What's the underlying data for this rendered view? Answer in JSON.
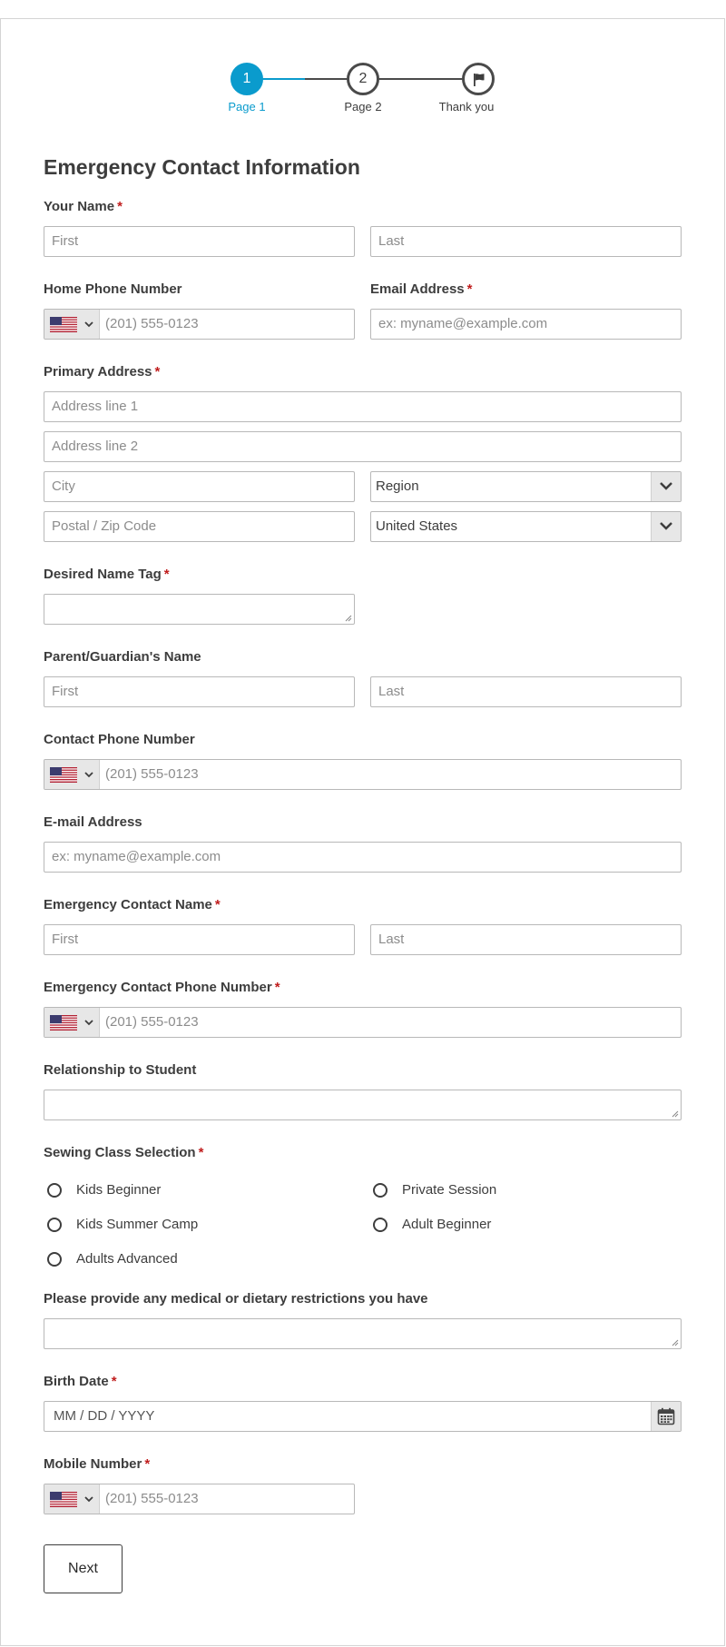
{
  "progress": {
    "steps": [
      {
        "number": "1",
        "label": "Page 1",
        "state": "active"
      },
      {
        "number": "2",
        "label": "Page 2",
        "state": "todo"
      },
      {
        "number": "",
        "label": "Thank you",
        "state": "todo",
        "icon": "flag-icon"
      }
    ],
    "colors": {
      "active": "#0a9bcd",
      "inactive": "#4a4a4a"
    }
  },
  "form": {
    "title": "Emergency Contact Information",
    "required_marker": "*",
    "your_name": {
      "label": "Your Name",
      "first_placeholder": "First",
      "last_placeholder": "Last"
    },
    "home_phone": {
      "label": "Home Phone Number",
      "placeholder": "(201) 555-0123",
      "country_icon": "us-flag-icon"
    },
    "email": {
      "label": "Email Address",
      "placeholder": "ex: myname@example.com"
    },
    "address": {
      "label": "Primary Address",
      "line1_placeholder": "Address line 1",
      "line2_placeholder": "Address line 2",
      "city_placeholder": "City",
      "region_value": "Region",
      "postal_placeholder": "Postal / Zip Code",
      "country_value": "United States"
    },
    "name_tag": {
      "label": "Desired Name Tag"
    },
    "guardian_name": {
      "label": "Parent/Guardian's Name",
      "first_placeholder": "First",
      "last_placeholder": "Last"
    },
    "contact_phone": {
      "label": "Contact Phone Number",
      "placeholder": "(201) 555-0123"
    },
    "contact_email": {
      "label": "E-mail Address",
      "placeholder": "ex: myname@example.com"
    },
    "emergency_name": {
      "label": "Emergency Contact Name",
      "first_placeholder": "First",
      "last_placeholder": "Last"
    },
    "emergency_phone": {
      "label": "Emergency Contact Phone Number",
      "placeholder": "(201) 555-0123"
    },
    "relationship": {
      "label": "Relationship to Student"
    },
    "sewing_class": {
      "label": "Sewing Class Selection",
      "options": [
        "Kids Beginner",
        "Private Session",
        "Kids Summer Camp",
        "Adult Beginner",
        "Adults Advanced"
      ]
    },
    "medical": {
      "label": "Please provide any medical or dietary restrictions you have"
    },
    "birth_date": {
      "label": "Birth Date",
      "placeholder": "MM / DD / YYYY"
    },
    "mobile": {
      "label": "Mobile Number",
      "placeholder": "(201) 555-0123"
    },
    "next_label": "Next"
  }
}
